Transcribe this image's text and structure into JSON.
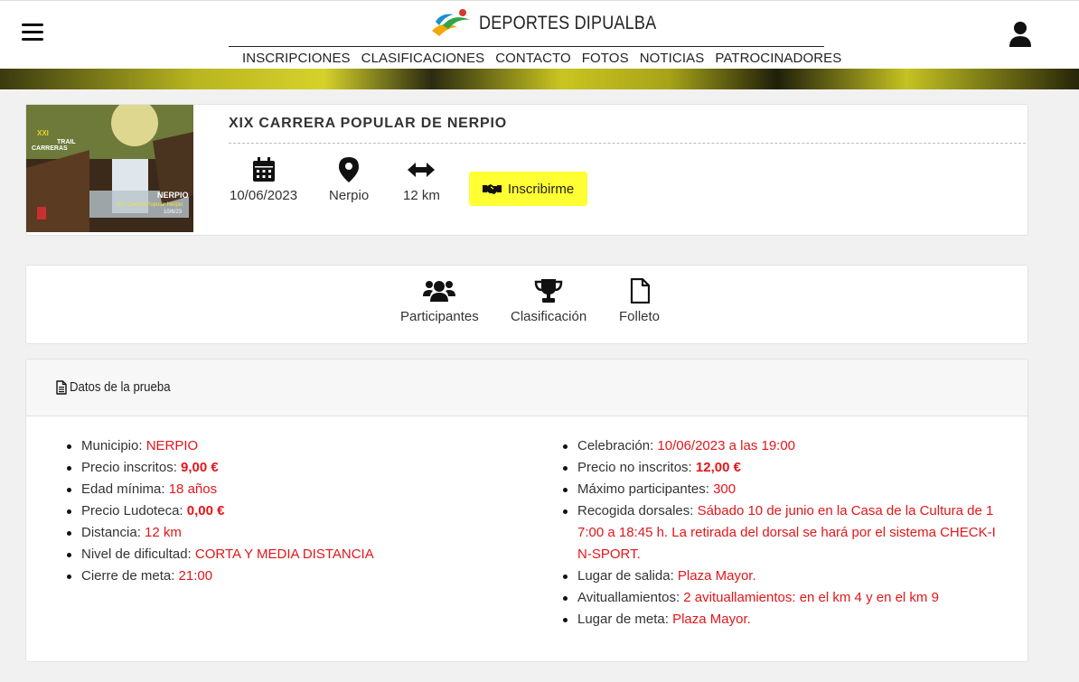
{
  "brand": {
    "name": "DEPORTES DIPUALBA"
  },
  "nav": [
    "INSCRIPCIONES",
    "CLASIFICACIONES",
    "CONTACTO",
    "FOTOS",
    "NOTICIAS",
    "PATROCINADORES"
  ],
  "event": {
    "title": "XIX CARRERA POPULAR DE NERPIO",
    "date": "10/06/2023",
    "place": "Nerpio",
    "distance": "12 km",
    "cta": "Inscribirme",
    "poster": {
      "line1": "XXI",
      "line2": "CARRERAS",
      "line3": "TRAIL",
      "location": "NERPIO",
      "subtitle": "XIX Carrera Popular Nerpio",
      "date": "10/6/23"
    }
  },
  "links": {
    "participants": "Participantes",
    "ranking": "Clasificación",
    "brochure": "Folleto"
  },
  "data_section": {
    "title": "Datos de la prueba",
    "left": [
      {
        "label": "Municipio: ",
        "value": "NERPIO",
        "bold": false
      },
      {
        "label": "Precio inscritos: ",
        "value": "9,00 €",
        "bold": true
      },
      {
        "label": "Edad mínima: ",
        "value": "18 años",
        "bold": false
      },
      {
        "label": "Precio  Ludoteca: ",
        "value": "0,00 €",
        "bold": true
      },
      {
        "label": "Distancia: ",
        "value": "12 km",
        "bold": false
      },
      {
        "label": "Nivel de dificultad: ",
        "value": "CORTA Y  MEDIA  DISTANCIA",
        "bold": false
      },
      {
        "label": "Cierre de meta: ",
        "value": "21:00",
        "bold": false
      }
    ],
    "right": [
      {
        "label": "Celebración: ",
        "value": "10/06/2023 a las 19:00",
        "bold": false
      },
      {
        "label": "Precio no inscritos: ",
        "value": "12,00 €",
        "bold": true
      },
      {
        "label": "Máximo participantes: ",
        "value": "300",
        "bold": false
      },
      {
        "label": "Recogida dorsales: ",
        "value": "Sábado 10 de junio en la Casa de la Cultura de 17:00 a 18:45 h.  La retirada del dorsal se hará por el sistema CHECK-IN-SPORT.",
        "bold": false
      },
      {
        "label": "Lugar de salida:  ",
        "value": "Plaza  Mayor.",
        "bold": false
      },
      {
        "label": "Avituallamientos: ",
        "value": "2 avituallamientos: en el km 4 y en el km 9",
        "bold": false
      },
      {
        "label": "Lugar de meta:  ",
        "value": "Plaza  Mayor.",
        "bold": false
      }
    ]
  },
  "colors": {
    "accent_yellow": "#ffff33",
    "value_red": "#e3161a"
  }
}
